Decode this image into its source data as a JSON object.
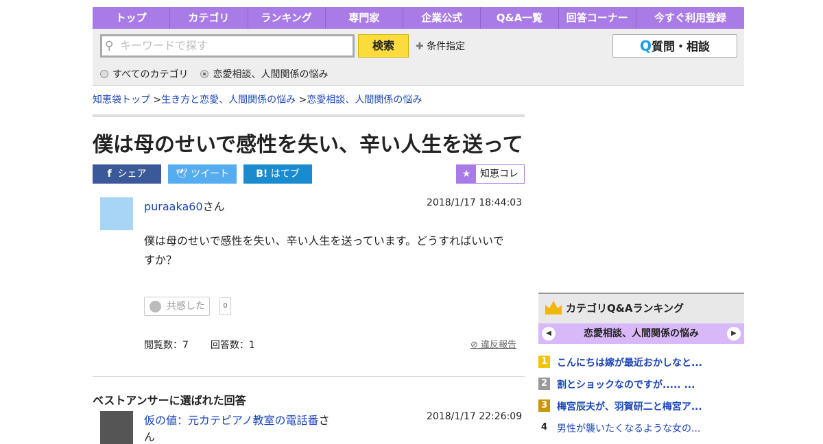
{
  "nav": [
    "トップ",
    "カテゴリ",
    "ランキング",
    "専門家",
    "企業公式",
    "Q&A一覧",
    "回答コーナー",
    "今すぐ利用登録"
  ],
  "search": {
    "placeholder": "キーワードで探す",
    "button": "検索",
    "conditions": "条件指定",
    "ask": "質問・相談",
    "radio_all": "すべてのカテゴリ",
    "radio_cat": "恋愛相談、人間関係の悩み"
  },
  "breadcrumb": [
    "知恵袋トップ",
    "生き方と恋愛、人間関係の悩み",
    "恋愛相談、人間関係の悩み"
  ],
  "title": "僕は母のせいで感性を失い、辛い人生を送って...",
  "share": {
    "fb": "シェア",
    "tw": "ツイート",
    "hb": "はてブ",
    "collect": "知恵コレ"
  },
  "question": {
    "user": "puraaka60",
    "san": "さん",
    "date": "2018/1/17  18:44:03",
    "text": "僕は母のせいで感性を失い、辛い人生を送っています。どうすればいいですか？",
    "empathy": "共感した",
    "empathy_count": "0",
    "views": "閲覧数：7",
    "answers": "回答数：1",
    "report": "違反報告"
  },
  "best": {
    "heading": "ベストアンサーに選ばれた回答",
    "user": "仮の値：元カテピアノ教室の電話番",
    "san": "さん",
    "date": "2018/1/17  22:26:09"
  },
  "ranking": {
    "title": "カテゴリQ&Aランキング",
    "category": "恋愛相談、人間関係の悩み",
    "items": [
      {
        "n": "1",
        "t": "こんにちは嫁が最近おかしなと...",
        "c": "#f5c400"
      },
      {
        "n": "2",
        "t": "割とショックなのですが..... ...",
        "c": "#999999"
      },
      {
        "n": "3",
        "t": "梅宮辰夫が、羽賀研二と梅宮ア...",
        "c": "#c9960a"
      },
      {
        "n": "4",
        "t": "男性が襲いたくなるような女の..."
      }
    ]
  }
}
